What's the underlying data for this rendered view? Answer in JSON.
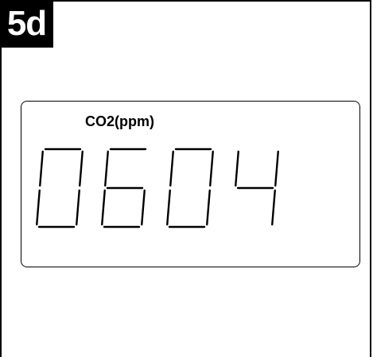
{
  "step": {
    "label": "5d"
  },
  "display": {
    "label": "CO2(ppm)",
    "value": "0604"
  },
  "colors": {
    "ink": "#000000",
    "background": "#ffffff"
  }
}
